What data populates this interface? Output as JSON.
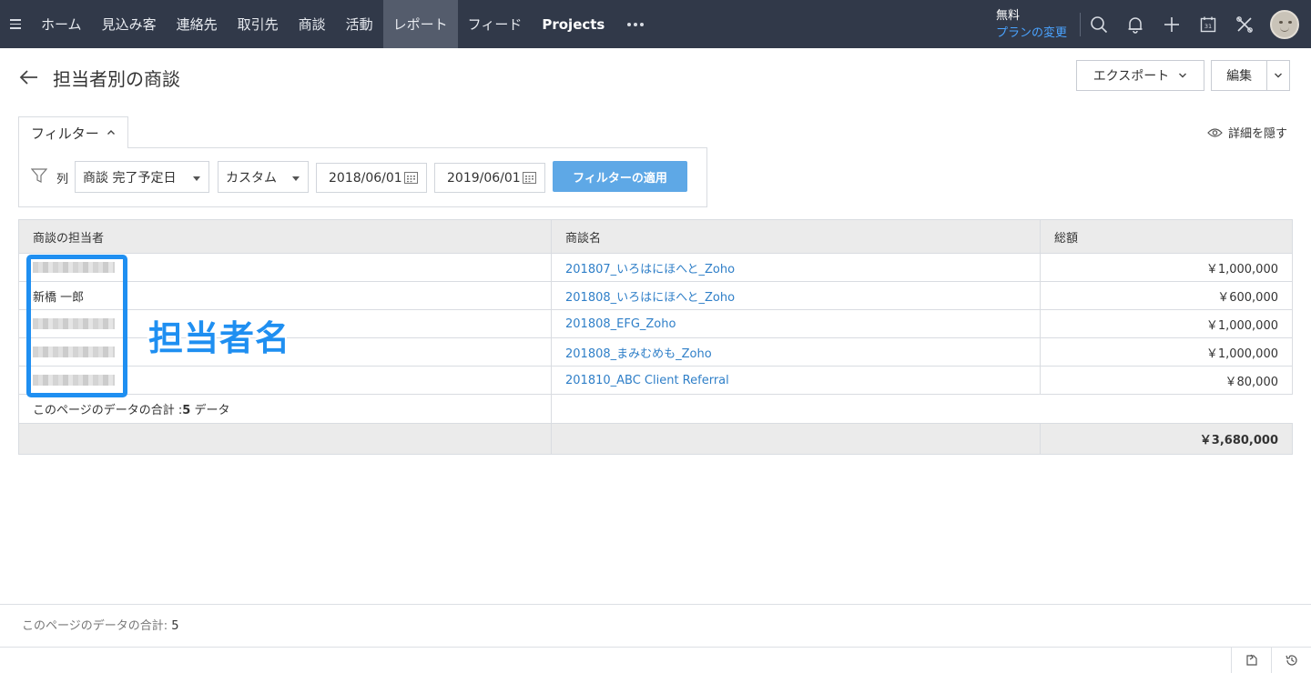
{
  "nav": {
    "items": [
      "ホーム",
      "見込み客",
      "連絡先",
      "取引先",
      "商談",
      "活動",
      "レポート",
      "フィード",
      "Projects"
    ],
    "active": "レポート",
    "more_icon": "ellipsis-icon"
  },
  "plan": {
    "label": "無料",
    "change_link": "プランの変更"
  },
  "header": {
    "title": "担当者別の商談",
    "export_label": "エクスポート",
    "edit_label": "編集"
  },
  "filter": {
    "tab_label": "フィルター",
    "hide_details": "詳細を隠す",
    "column_label": "列",
    "field_select": "商談 完了予定日",
    "range_select": "カスタム",
    "date_from": "2018/06/01",
    "date_to": "2019/06/01",
    "apply_label": "フィルターの適用"
  },
  "table": {
    "headers": [
      "商談の担当者",
      "商談名",
      "総額"
    ],
    "rows": [
      {
        "owner": "",
        "deal": "201807_いろはにほへと_Zoho",
        "amount": "￥1,000,000",
        "owner_blurred": true
      },
      {
        "owner": "新橋 一郎",
        "deal": "201808_いろはにほへと_Zoho",
        "amount": "￥600,000",
        "owner_blurred": false
      },
      {
        "owner": "",
        "deal": "201808_EFG_Zoho",
        "amount": "￥1,000,000",
        "owner_blurred": true
      },
      {
        "owner": "",
        "deal": "201808_まみむめも_Zoho",
        "amount": "￥1,000,000",
        "owner_blurred": true
      },
      {
        "owner": "",
        "deal": "201810_ABC Client Referral",
        "amount": "￥80,000",
        "owner_blurred": true
      }
    ],
    "page_count_prefix": "このページのデータの合計 :",
    "page_count_value": "5",
    "page_count_suffix": " データ",
    "total": "￥3,680,000"
  },
  "annotation": {
    "text": "担当者名",
    "color": "#1f8ff1"
  },
  "footer": {
    "label": "このページのデータの合計: ",
    "count": "5"
  },
  "colors": {
    "nav_bg": "#313949",
    "link": "#2f7fc8",
    "apply_btn": "#5ea8e6",
    "accent": "#4aa3ff"
  }
}
